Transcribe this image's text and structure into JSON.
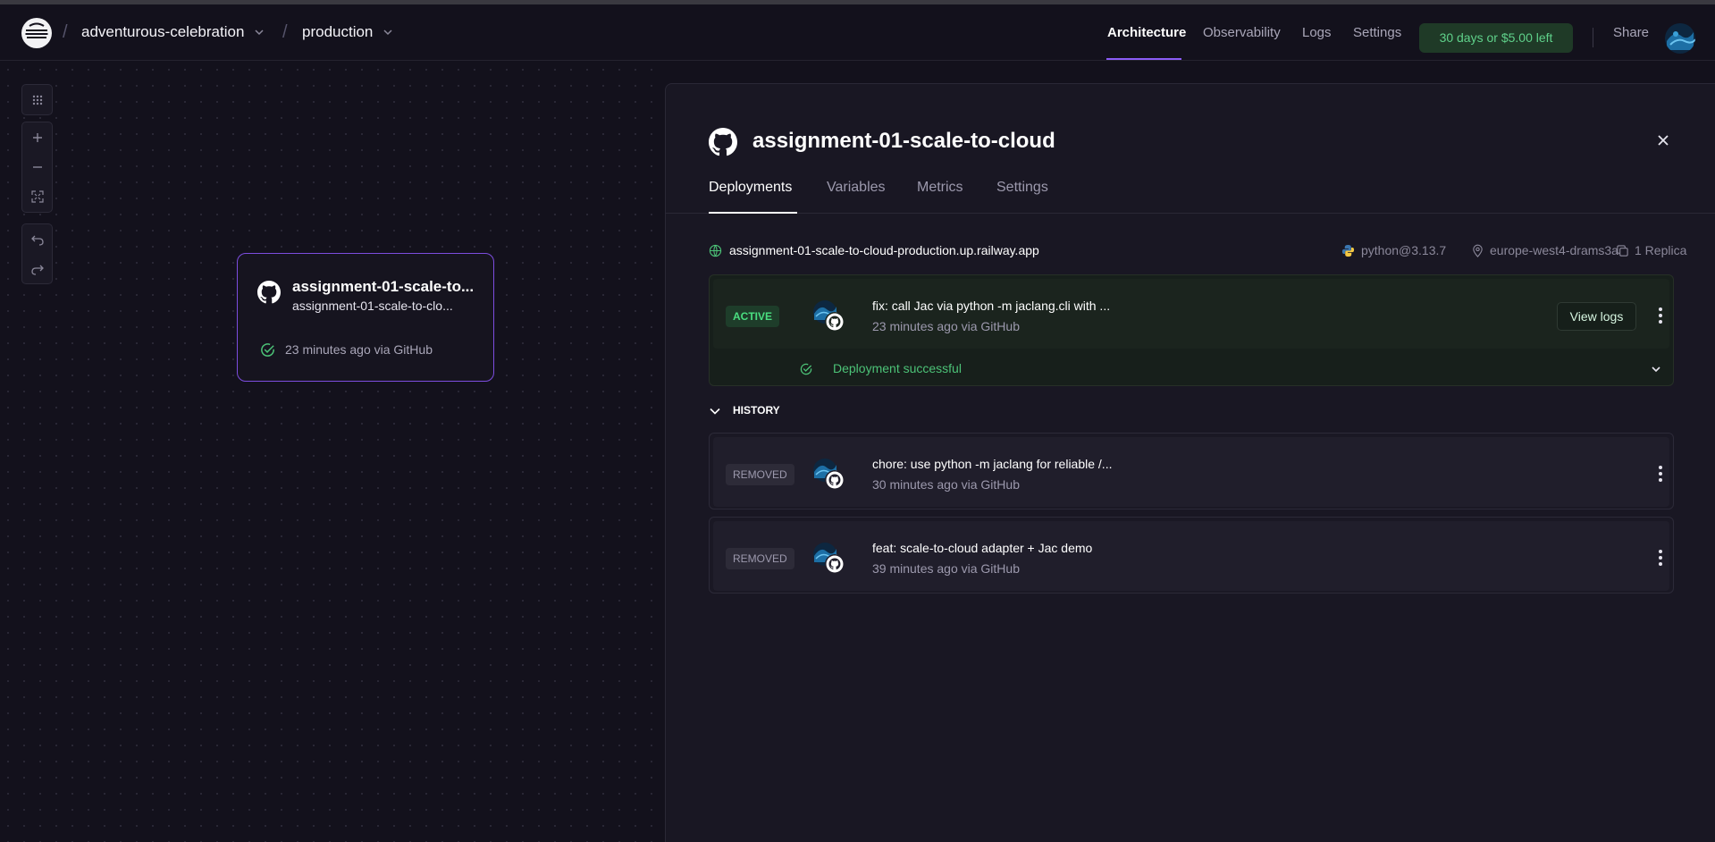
{
  "header": {
    "project": "adventurous-celebration",
    "environment": "production",
    "nav": [
      "Architecture",
      "Observability",
      "Logs",
      "Settings"
    ],
    "active_nav": "Architecture",
    "trial": "30 days or $5.00 left",
    "share": "Share"
  },
  "canvas": {
    "tools": [
      "grid-icon",
      "zoom-in-icon",
      "zoom-out-icon",
      "fit-view-icon",
      "undo-icon",
      "redo-icon"
    ],
    "service": {
      "title": "assignment-01-scale-to...",
      "subtitle": "assignment-01-scale-to-clo...",
      "status": "23 minutes ago via GitHub"
    }
  },
  "panel": {
    "title": "assignment-01-scale-to-cloud",
    "tabs": [
      "Deployments",
      "Variables",
      "Metrics",
      "Settings"
    ],
    "active_tab": "Deployments",
    "domain": "assignment-01-scale-to-cloud-production.up.railway.app",
    "runtime": "python@3.13.7",
    "region": "europe-west4-drams3a",
    "replicas": "1 Replica",
    "active_deployment": {
      "badge": "ACTIVE",
      "message": "fix: call Jac via python -m jaclang.cli with ...",
      "time": "23 minutes ago via GitHub",
      "view_logs": "View logs",
      "status": "Deployment successful"
    },
    "history_label": "HISTORY",
    "history": [
      {
        "badge": "REMOVED",
        "message": "chore: use python -m jaclang for reliable /...",
        "time": "30 minutes ago via GitHub"
      },
      {
        "badge": "REMOVED",
        "message": "feat: scale-to-cloud adapter + Jac demo",
        "time": "39 minutes ago via GitHub"
      }
    ]
  },
  "colors": {
    "background": "#13111c",
    "panel": "#191723",
    "accent": "#8b5cf6",
    "success": "#4ade80"
  }
}
